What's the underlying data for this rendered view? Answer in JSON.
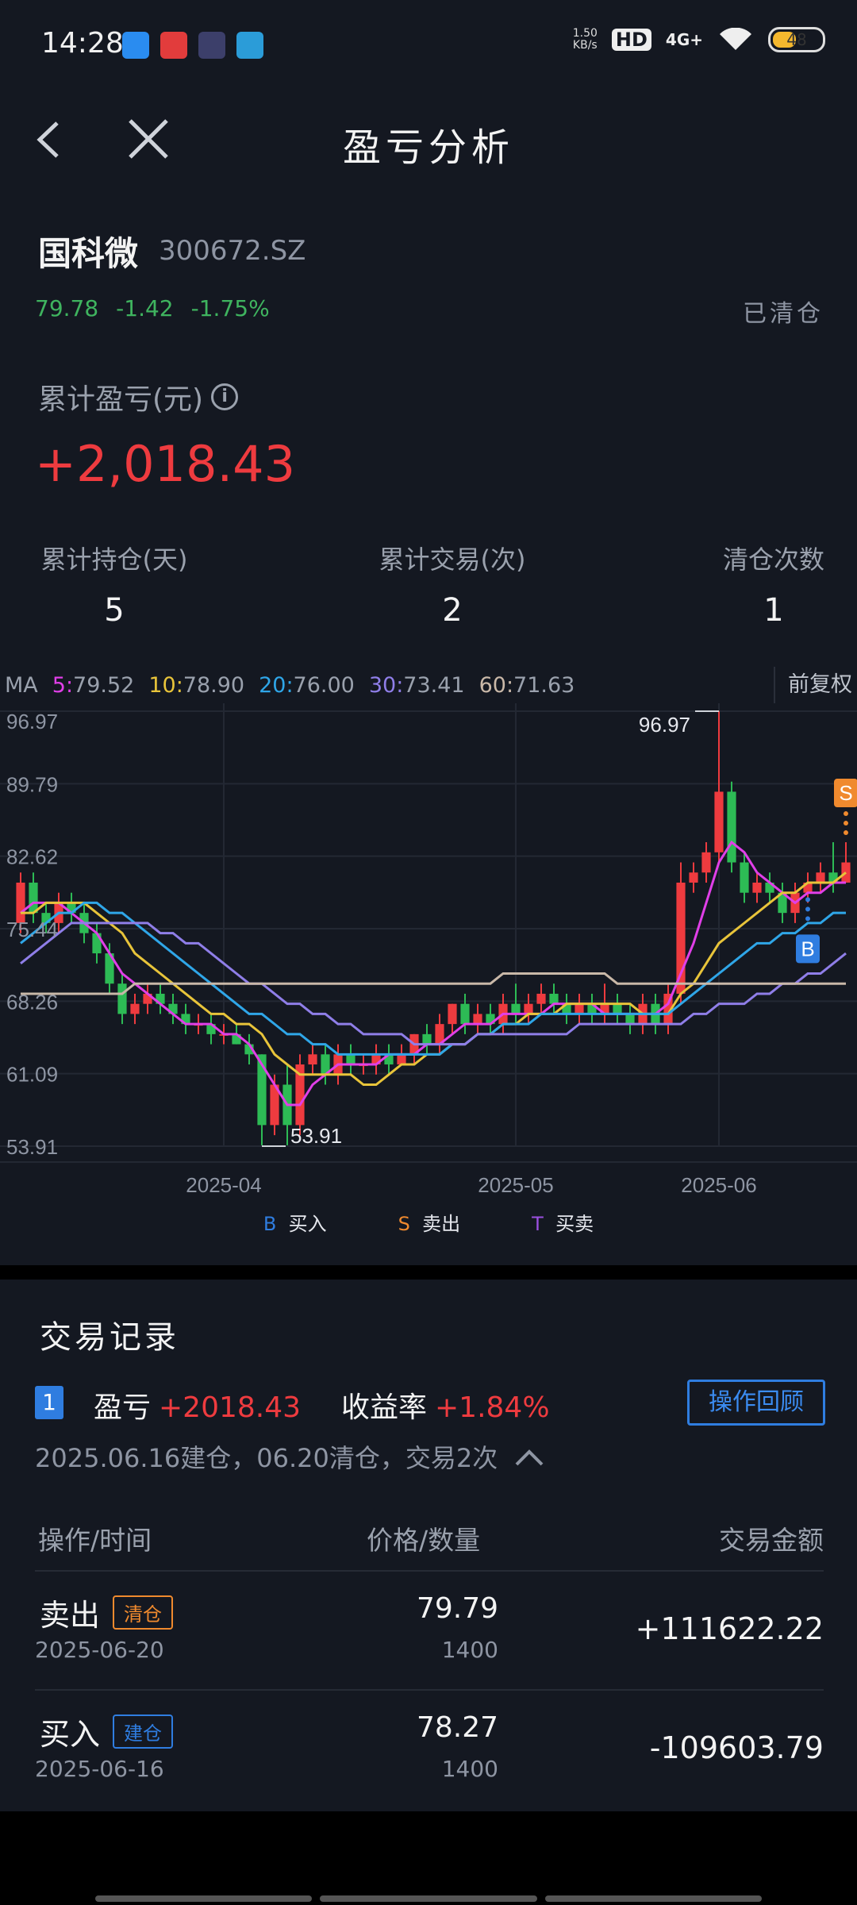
{
  "status_bar": {
    "time": "14:28",
    "net_speed": "1.50",
    "net_speed_unit": "KB/s",
    "hd": "HD",
    "signal": "4G+",
    "battery": "48",
    "battery_level": 0.48,
    "app_icons": [
      "app-icon-blue",
      "app-icon-red-chart",
      "app-icon-purple",
      "app-icon-green"
    ]
  },
  "header": {
    "title": "盈亏分析",
    "back_icon": "chevron-left-icon",
    "close_icon": "close-icon"
  },
  "stock": {
    "name": "国科微",
    "code": "300672.SZ",
    "price": "79.78",
    "change": "-1.42",
    "change_pct": "-1.75%",
    "status": "已清仓"
  },
  "pnl": {
    "label": "累计盈亏(元)",
    "value": "+2,018.43"
  },
  "stats": [
    {
      "label": "累计持仓(天)",
      "value": "5"
    },
    {
      "label": "累计交易(次)",
      "value": "2"
    },
    {
      "label": "清仓次数",
      "value": "1"
    }
  ],
  "ma_bar": {
    "prefix": "MA",
    "items": [
      {
        "key": "5:",
        "value": "79.52",
        "color": "#e03fe8"
      },
      {
        "key": "10:",
        "value": "78.90",
        "color": "#e8c43a"
      },
      {
        "key": "20:",
        "value": "76.00",
        "color": "#2fa6e8"
      },
      {
        "key": "30:",
        "value": "73.41",
        "color": "#8f7ee8"
      },
      {
        "key": "60:",
        "value": "71.63",
        "color": "#c9b8a8"
      }
    ],
    "adjust_label": "前复权"
  },
  "chart_data": {
    "type": "candlestick",
    "y_ticks": [
      "96.97",
      "89.79",
      "82.62",
      "75.44",
      "68.26",
      "61.09",
      "53.91"
    ],
    "ylim": [
      53.91,
      96.97
    ],
    "x_ticks": [
      "2025-04",
      "2025-05",
      "2025-06"
    ],
    "max_label": "96.97",
    "min_label": "53.91",
    "candles": [
      [
        76,
        80,
        81,
        75
      ],
      [
        80,
        77,
        81,
        76
      ],
      [
        77,
        76,
        78,
        75
      ],
      [
        76,
        78,
        79,
        75
      ],
      [
        78,
        77,
        79,
        76
      ],
      [
        77,
        75,
        78,
        74
      ],
      [
        75,
        73,
        76,
        72
      ],
      [
        73,
        70,
        74,
        69
      ],
      [
        70,
        67,
        71,
        66
      ],
      [
        67,
        68,
        69,
        66
      ],
      [
        68,
        69,
        70,
        67
      ],
      [
        69,
        68,
        70,
        67
      ],
      [
        68,
        67,
        69,
        66
      ],
      [
        67,
        66,
        68,
        65
      ],
      [
        66,
        66,
        67,
        65
      ],
      [
        66,
        65,
        67,
        64
      ],
      [
        65,
        65,
        66,
        64
      ],
      [
        65,
        64,
        66,
        64
      ],
      [
        64,
        63,
        65,
        62
      ],
      [
        63,
        56,
        63,
        54
      ],
      [
        56,
        60,
        61,
        55
      ],
      [
        60,
        56,
        62,
        54
      ],
      [
        56,
        62,
        63,
        55
      ],
      [
        62,
        63,
        64,
        61
      ],
      [
        63,
        61,
        64,
        60
      ],
      [
        61,
        63,
        64,
        60
      ],
      [
        63,
        62,
        64,
        61
      ],
      [
        62,
        62,
        63,
        61
      ],
      [
        62,
        63,
        64,
        61
      ],
      [
        63,
        62,
        64,
        61
      ],
      [
        62,
        63,
        64,
        62
      ],
      [
        63,
        65,
        65,
        62
      ],
      [
        65,
        64,
        66,
        63
      ],
      [
        64,
        66,
        67,
        63
      ],
      [
        66,
        68,
        68,
        65
      ],
      [
        68,
        66,
        69,
        65
      ],
      [
        66,
        67,
        68,
        65
      ],
      [
        67,
        66,
        68,
        65
      ],
      [
        66,
        68,
        69,
        65
      ],
      [
        68,
        67,
        70,
        66
      ],
      [
        67,
        68,
        69,
        66
      ],
      [
        68,
        69,
        70,
        67
      ],
      [
        69,
        68,
        70,
        67
      ],
      [
        68,
        67,
        69,
        66
      ],
      [
        67,
        68,
        69,
        66
      ],
      [
        68,
        67,
        69,
        66
      ],
      [
        67,
        68,
        70,
        66
      ],
      [
        68,
        67,
        69,
        66
      ],
      [
        67,
        66,
        68,
        65
      ],
      [
        66,
        68,
        69,
        65
      ],
      [
        68,
        66,
        69,
        65
      ],
      [
        66,
        69,
        70,
        65
      ],
      [
        69,
        80,
        82,
        68
      ],
      [
        80,
        81,
        82,
        79
      ],
      [
        81,
        83,
        84,
        80
      ],
      [
        83,
        89,
        97,
        82
      ],
      [
        89,
        82,
        90,
        81
      ],
      [
        82,
        79,
        83,
        78
      ],
      [
        79,
        80,
        81,
        78
      ],
      [
        80,
        79,
        81,
        78
      ],
      [
        79,
        77,
        80,
        76
      ],
      [
        77,
        79,
        80,
        76
      ],
      [
        79,
        80,
        81,
        78
      ],
      [
        80,
        81,
        82,
        79
      ],
      [
        81,
        80,
        84,
        79
      ],
      [
        80,
        82,
        84,
        80
      ]
    ],
    "series": [
      {
        "name": "MA5",
        "color": "#e03fe8",
        "values": [
          77,
          78,
          78,
          78,
          77,
          76,
          75,
          73,
          71,
          70,
          69,
          68,
          67,
          66,
          66,
          66,
          65,
          65,
          64,
          62,
          60,
          58,
          58,
          60,
          61,
          62,
          62,
          62,
          62,
          63,
          63,
          63,
          64,
          64,
          65,
          66,
          66,
          66,
          67,
          67,
          67,
          67,
          68,
          68,
          68,
          68,
          67,
          67,
          67,
          67,
          67,
          68,
          71,
          74,
          78,
          82,
          84,
          83,
          81,
          80,
          79,
          78,
          79,
          79,
          80,
          80
        ]
      },
      {
        "name": "MA10",
        "color": "#e8c43a",
        "values": [
          77,
          77,
          78,
          78,
          78,
          78,
          77,
          76,
          75,
          73,
          72,
          71,
          70,
          69,
          68,
          67,
          67,
          66,
          66,
          65,
          63,
          62,
          61,
          61,
          61,
          61,
          61,
          60,
          60,
          61,
          62,
          62,
          63,
          63,
          64,
          64,
          65,
          65,
          66,
          66,
          67,
          67,
          67,
          68,
          68,
          68,
          68,
          68,
          68,
          67,
          67,
          67,
          69,
          70,
          72,
          74,
          75,
          76,
          77,
          78,
          79,
          79,
          80,
          80,
          80,
          81
        ]
      },
      {
        "name": "MA20",
        "color": "#2fa6e8",
        "values": [
          74,
          75,
          76,
          77,
          77,
          78,
          78,
          77,
          77,
          76,
          75,
          74,
          73,
          72,
          71,
          70,
          69,
          68,
          67,
          67,
          66,
          65,
          65,
          64,
          64,
          63,
          63,
          63,
          63,
          63,
          63,
          63,
          63,
          63,
          64,
          64,
          65,
          65,
          66,
          66,
          66,
          67,
          67,
          67,
          67,
          67,
          67,
          67,
          67,
          67,
          67,
          67,
          68,
          69,
          70,
          71,
          72,
          73,
          74,
          74,
          75,
          75,
          76,
          76,
          77,
          77
        ]
      },
      {
        "name": "MA30",
        "color": "#8f7ee8",
        "values": [
          72,
          73,
          74,
          75,
          76,
          76,
          76,
          76,
          76,
          76,
          76,
          75,
          75,
          74,
          74,
          73,
          72,
          71,
          70,
          70,
          69,
          68,
          68,
          67,
          67,
          66,
          66,
          65,
          65,
          65,
          65,
          64,
          64,
          64,
          64,
          64,
          65,
          65,
          65,
          65,
          65,
          65,
          65,
          65,
          66,
          66,
          66,
          66,
          66,
          66,
          66,
          66,
          66,
          67,
          67,
          68,
          68,
          68,
          69,
          69,
          70,
          70,
          71,
          71,
          72,
          73
        ]
      },
      {
        "name": "MA60",
        "color": "#c9b8a8",
        "values": [
          69,
          69,
          69,
          69,
          69,
          69,
          69,
          69,
          69,
          70,
          70,
          70,
          70,
          70,
          70,
          70,
          70,
          70,
          70,
          70,
          70,
          70,
          70,
          70,
          70,
          70,
          70,
          70,
          70,
          70,
          70,
          70,
          70,
          70,
          70,
          70,
          70,
          70,
          71,
          71,
          71,
          71,
          71,
          71,
          71,
          71,
          71,
          70,
          70,
          70,
          70,
          70,
          70,
          70,
          70,
          70,
          70,
          70,
          70,
          70,
          70,
          70,
          70,
          70,
          70,
          70
        ]
      }
    ],
    "markers": [
      {
        "type": "S",
        "index": 65
      },
      {
        "type": "B",
        "index": 62
      }
    ]
  },
  "legend": [
    {
      "key": "B",
      "label": "买入",
      "color": "#2f7de0"
    },
    {
      "key": "S",
      "label": "卖出",
      "color": "#f08a2e"
    },
    {
      "key": "T",
      "label": "买卖",
      "color": "#9b4fe0"
    }
  ],
  "records": {
    "title": "交易记录",
    "trade": {
      "index": "1",
      "pnl_label": "盈亏",
      "pnl_value": "+2018.43",
      "rate_label": "收益率",
      "rate_value": "+1.84%",
      "review_button": "操作回顾",
      "summary": "2025.06.16建仓，06.20清仓，交易2次"
    },
    "headers": [
      "操作/时间",
      "价格/数量",
      "交易金额"
    ],
    "rows": [
      {
        "op": "卖出",
        "tag": "清仓",
        "date": "2025-06-20",
        "price": "79.79",
        "qty": "1400",
        "amount": "+111622.22",
        "tag_color": "#f08a2e"
      },
      {
        "op": "买入",
        "tag": "建仓",
        "date": "2025-06-16",
        "price": "78.27",
        "qty": "1400",
        "amount": "-109603.79",
        "tag_color": "#2f7de0"
      }
    ]
  }
}
